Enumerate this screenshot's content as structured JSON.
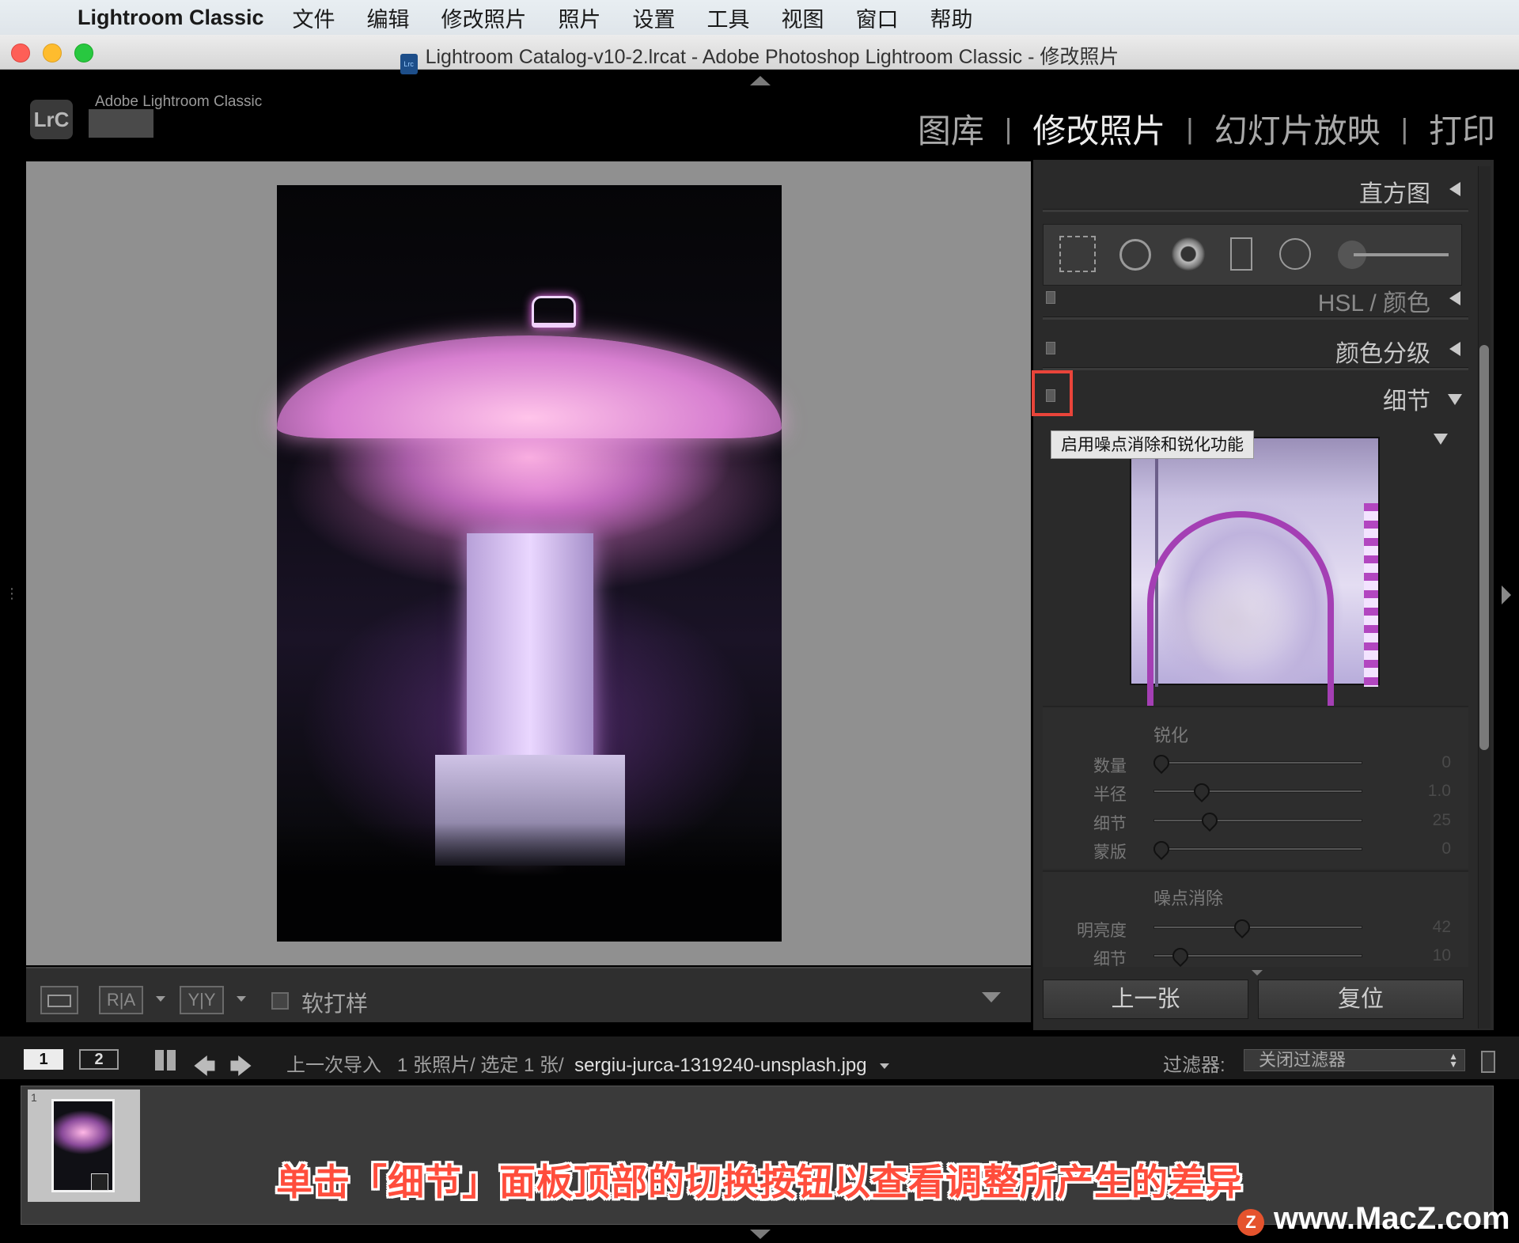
{
  "menubar": {
    "app_name": "Lightroom Classic",
    "items": [
      "文件",
      "编辑",
      "修改照片",
      "照片",
      "设置",
      "工具",
      "视图",
      "窗口",
      "帮助"
    ]
  },
  "window": {
    "title": "Lightroom Catalog-v10-2.lrcat - Adobe Photoshop Lightroom Classic - 修改照片"
  },
  "identity": {
    "logo_text": "LrC",
    "brand": "Adobe Lightroom Classic"
  },
  "modules": [
    "图库",
    "修改照片",
    "幻灯片放映",
    "打印"
  ],
  "active_module": "修改照片",
  "toolbar": {
    "ra_label": "R|A",
    "yy_label": "Y|Y",
    "soft_proof_label": "软打样"
  },
  "right_panel": {
    "histogram": "直方图",
    "hsl": "HSL / 颜色",
    "color_grading": "颜色分级",
    "detail": "细节",
    "tooltip": "启用噪点消除和锐化功能",
    "sharpening": {
      "title": "锐化",
      "rows": [
        {
          "label": "数量",
          "value": "0",
          "level": 0
        },
        {
          "label": "半径",
          "value": "1.0",
          "level": 0.21
        },
        {
          "label": "细节",
          "value": "25",
          "level": 0.25
        },
        {
          "label": "蒙版",
          "value": "0",
          "level": 0
        }
      ]
    },
    "noise_reduction": {
      "title": "噪点消除",
      "rows": [
        {
          "label": "明亮度",
          "value": "42",
          "level": 0.42
        },
        {
          "label": "细节",
          "value": "10",
          "level": 0.1
        }
      ]
    },
    "prev_button": "上一张",
    "reset_button": "复位"
  },
  "filmstrip_bar": {
    "page1": "1",
    "page2": "2",
    "source": "上一次导入",
    "count": "1 张照片/ 选定 1 张/",
    "filename": "sergiu-jurca-1319240-unsplash.jpg",
    "filter_label": "过滤器:",
    "filter_value": "关闭过滤器"
  },
  "filmstrip": {
    "thumb_number": "1"
  },
  "caption": "单击「细节」面板顶部的切换按钮以查看调整所产生的差异",
  "watermark": {
    "logo": "Z",
    "text": "www.MacZ.com"
  }
}
